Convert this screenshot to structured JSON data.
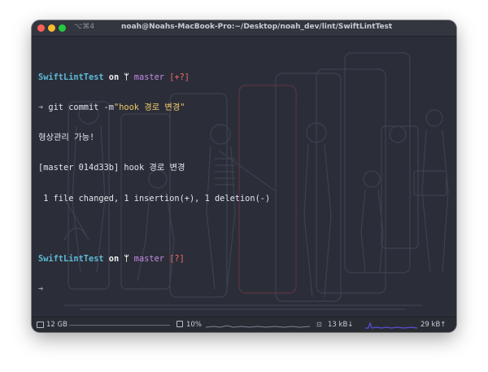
{
  "window": {
    "tab_shortcut": "⌥⌘4",
    "title": "noah@Noahs-MacBook-Pro:~/Desktop/noah_dev/lint/SwiftLintTest"
  },
  "terminal": {
    "prompt1": {
      "dir": "SwiftLintTest",
      "on": "on",
      "branch_glyph": "ᛘ",
      "branch": "master",
      "status": "[+?]"
    },
    "command": {
      "arrow": "➜",
      "text": " git commit -m",
      "message": "\"hook 경로 변경\""
    },
    "output": [
      "형상관리 가능!",
      "[master 014d33b] hook 경로 변경",
      " 1 file changed, 1 insertion(+), 1 deletion(-)"
    ],
    "prompt2": {
      "dir": "SwiftLintTest",
      "on": "on",
      "branch_glyph": "ᛘ",
      "branch": "master",
      "status": "[?]"
    },
    "prompt2_arrow": "➜"
  },
  "statusbar": {
    "disk": "12 GB",
    "cpu": "10%",
    "net_down": "13 kB↓",
    "net_up": "29 kB↑"
  }
}
